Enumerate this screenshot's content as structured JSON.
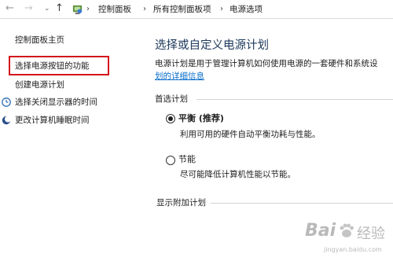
{
  "address_bar": {
    "back_icon": "arrow-left-icon",
    "forward_icon": "arrow-right-icon",
    "up_icon": "arrow-up-icon",
    "breadcrumbs": [
      "控制面板",
      "所有控制面板项",
      "电源选项"
    ]
  },
  "sidebar": {
    "items": [
      {
        "label": "控制面板主页"
      },
      {
        "label": "选择电源按钮的功能"
      },
      {
        "label": "创建电源计划"
      },
      {
        "label": "选择关闭显示器的时间"
      },
      {
        "label": "更改计算机睡眠时间"
      }
    ]
  },
  "main": {
    "title": "选择或自定义电源计划",
    "description": "电源计划是用于管理计算机如何使用电源的一套硬件和系统设",
    "description_link": "划的详细信息",
    "preferred_section": "首选计划",
    "plans": [
      {
        "name": "平衡 (推荐)",
        "description": "利用可用的硬件自动平衡功耗与性能。",
        "selected": true
      },
      {
        "name": "节能",
        "description": "尽可能降低计算机性能以节能。",
        "selected": false
      }
    ],
    "additional_section": "显示附加计划"
  },
  "watermark": {
    "text_main": "Bai",
    "text_jingyan": "经验",
    "text_url": "jingyan.baidu.com"
  },
  "colors": {
    "highlight_box": "#d4151b",
    "title": "#1e395b",
    "link": "#0b6ecb"
  }
}
